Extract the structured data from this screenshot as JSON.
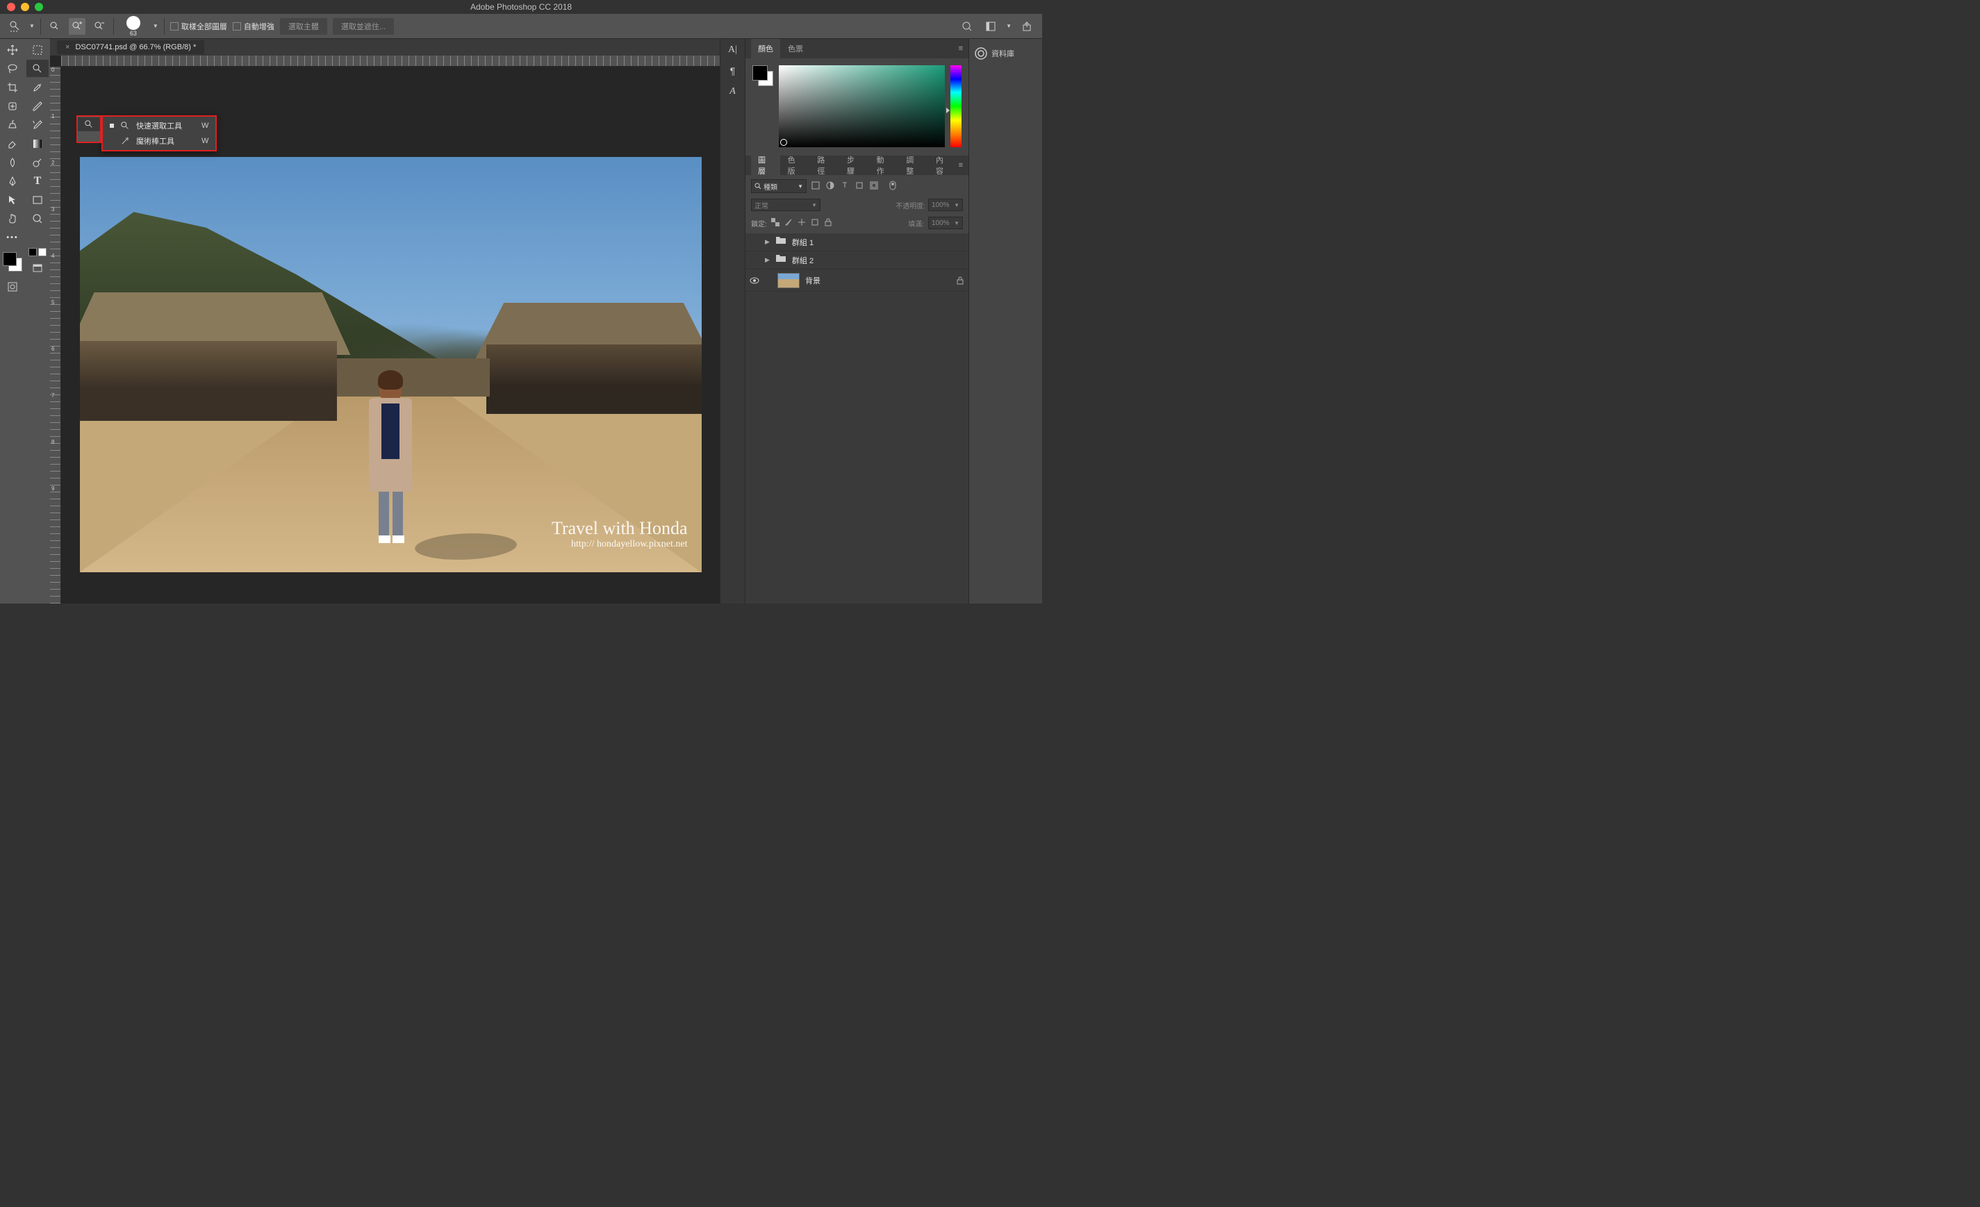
{
  "app": {
    "title": "Adobe Photoshop CC 2018"
  },
  "options_bar": {
    "brush_size": "63",
    "sample_all_layers": "取樣全部圖層",
    "auto_enhance": "自動增強",
    "select_subject": "選取主體",
    "select_and_mask": "選取並遮住..."
  },
  "document": {
    "tab_title": "DSC07741.psd @ 66.7% (RGB/8) *"
  },
  "tool_flyout": {
    "items": [
      {
        "label": "快速選取工具",
        "shortcut": "W",
        "active": true
      },
      {
        "label": "魔術棒工具",
        "shortcut": "W",
        "active": false
      }
    ]
  },
  "watermark": {
    "main": "Travel with Honda",
    "sub": "http:// hondayellow.pixnet.net"
  },
  "panels": {
    "color": {
      "tab1": "顏色",
      "tab2": "色票"
    },
    "layers": {
      "tabs": [
        "圖層",
        "色版",
        "路徑",
        "步驟",
        "動作",
        "調整",
        "內容"
      ],
      "kind_filter": "種類",
      "blend_mode": "正常",
      "opacity_label": "不透明度:",
      "opacity_value": "100%",
      "lock_label": "鎖定:",
      "fill_label": "填滿:",
      "fill_value": "100%",
      "items": [
        {
          "name": "群組 1",
          "type": "folder",
          "visible": false
        },
        {
          "name": "群組 2",
          "type": "folder",
          "visible": false
        },
        {
          "name": "背景",
          "type": "image",
          "visible": true,
          "locked": true
        }
      ]
    },
    "library": "資料庫"
  },
  "ruler_v": [
    "0",
    "1",
    "2",
    "3",
    "4",
    "5",
    "6",
    "7",
    "8",
    "9"
  ],
  "colors": {
    "accent_red": "#e02020",
    "bg_dark": "#262626",
    "panel": "#454545"
  }
}
